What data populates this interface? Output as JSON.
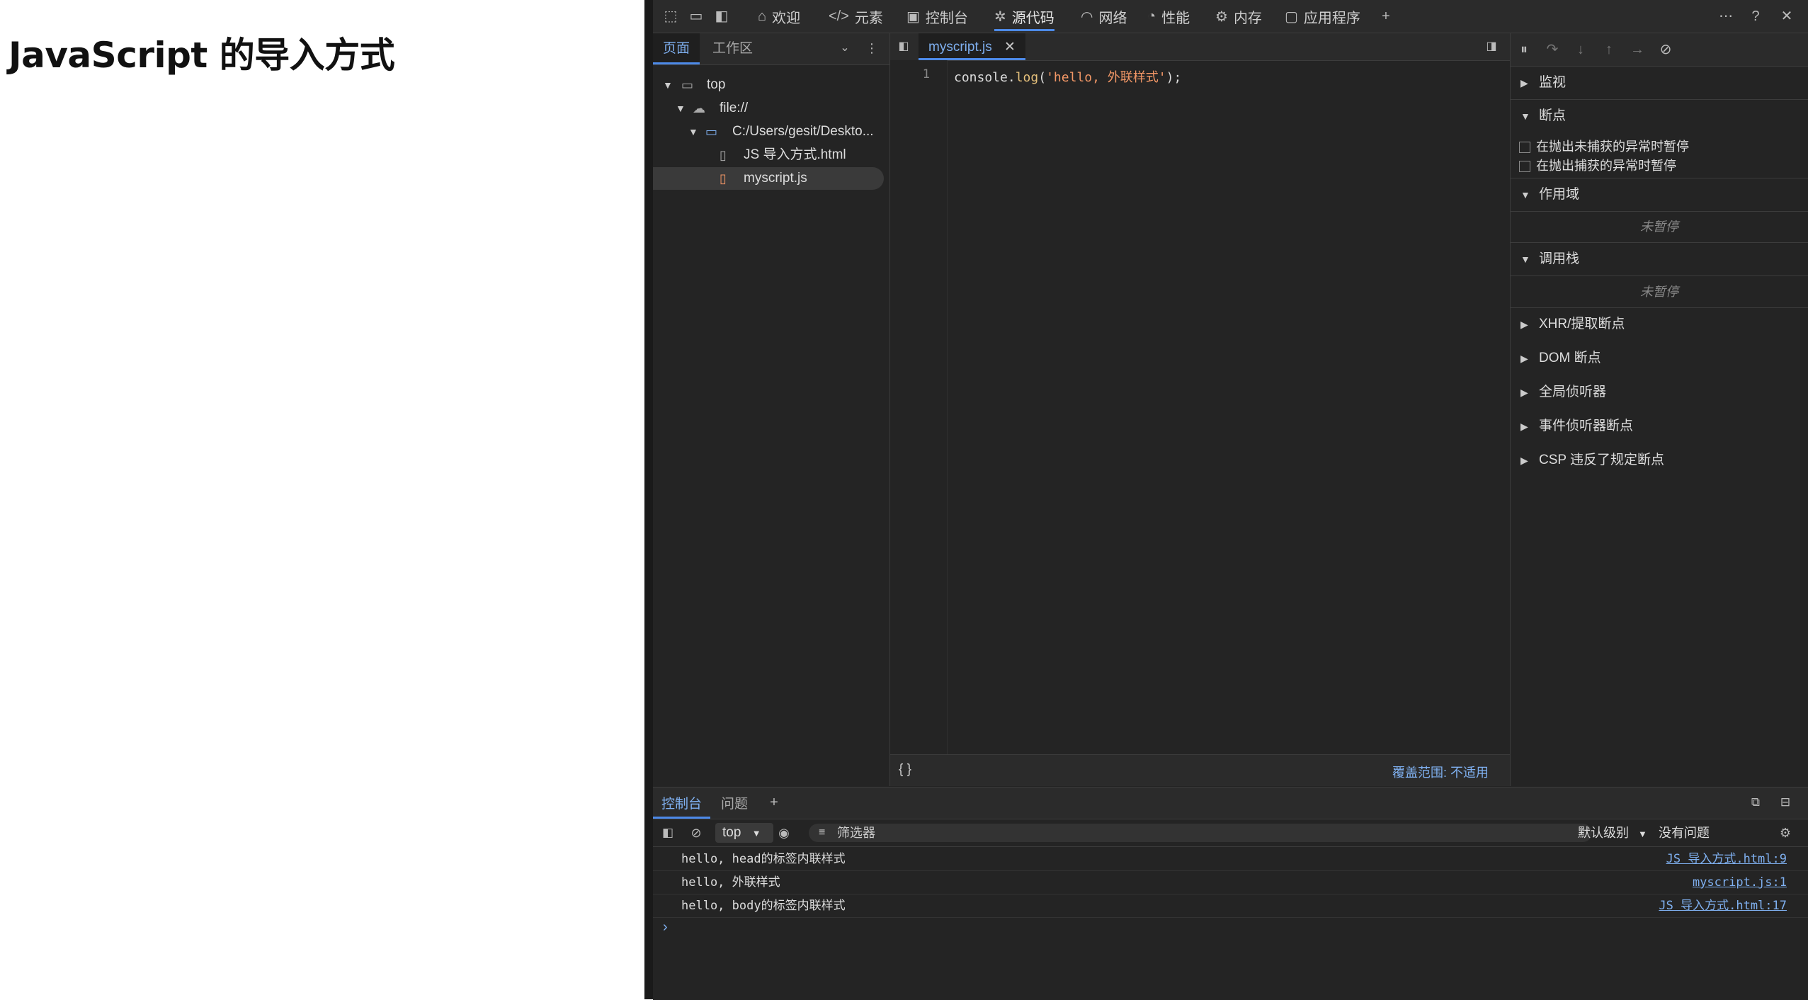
{
  "page": {
    "heading": "JavaScript 的导入方式"
  },
  "devtools_tabs": [
    {
      "label": "欢迎",
      "icon": "home-icon"
    },
    {
      "label": "元素",
      "icon": "code-icon"
    },
    {
      "label": "控制台",
      "icon": "console-icon"
    },
    {
      "label": "源代码",
      "icon": "bug-icon",
      "active": true
    },
    {
      "label": "网络",
      "icon": "wifi-icon"
    },
    {
      "label": "性能",
      "icon": "gauge-icon"
    },
    {
      "label": "内存",
      "icon": "gear-icon"
    },
    {
      "label": "应用程序",
      "icon": "app-icon"
    }
  ],
  "navigator": {
    "tab_page": "页面",
    "tab_workspace": "工作区",
    "tree": [
      {
        "label": "top"
      },
      {
        "label": "file://"
      },
      {
        "label": "C:/Users/gesit/Deskto..."
      },
      {
        "label": "JS 导入方式.html"
      },
      {
        "label": "myscript.js",
        "selected": true
      }
    ]
  },
  "editor": {
    "tab_label": "myscript.js",
    "line_number": "1",
    "code": {
      "pre": "console.",
      "fn": "log",
      "open": "(",
      "str": "'hello, 外联样式'",
      "close": ");"
    },
    "pretty_print": "{ }",
    "coverage": "覆盖范围: 不适用"
  },
  "debugger": {
    "sections": {
      "watch": "监视",
      "breakpoints": "断点",
      "cb_uncaught": "在抛出未捕获的异常时暂停",
      "cb_caught": "在抛出捕获的异常时暂停",
      "scope": "作用域",
      "scope_note": "未暂停",
      "callstack": "调用栈",
      "callstack_note": "未暂停",
      "xhr": "XHR/提取断点",
      "dom": "DOM 断点",
      "global": "全局侦听器",
      "event": "事件侦听器断点",
      "csp": "CSP 违反了规定断点"
    }
  },
  "drawer": {
    "tab_console": "控制台",
    "tab_issues": "问题",
    "context": "top",
    "filter_placeholder": "筛选器",
    "level": "默认级别",
    "issues": "没有问题",
    "logs": [
      {
        "msg": "hello, head的标签内联样式",
        "src": "JS 导入方式.html:9"
      },
      {
        "msg": "hello, 外联样式",
        "src": "myscript.js:1"
      },
      {
        "msg": "hello, body的标签内联样式",
        "src": "JS 导入方式.html:17"
      }
    ],
    "prompt": "›"
  }
}
